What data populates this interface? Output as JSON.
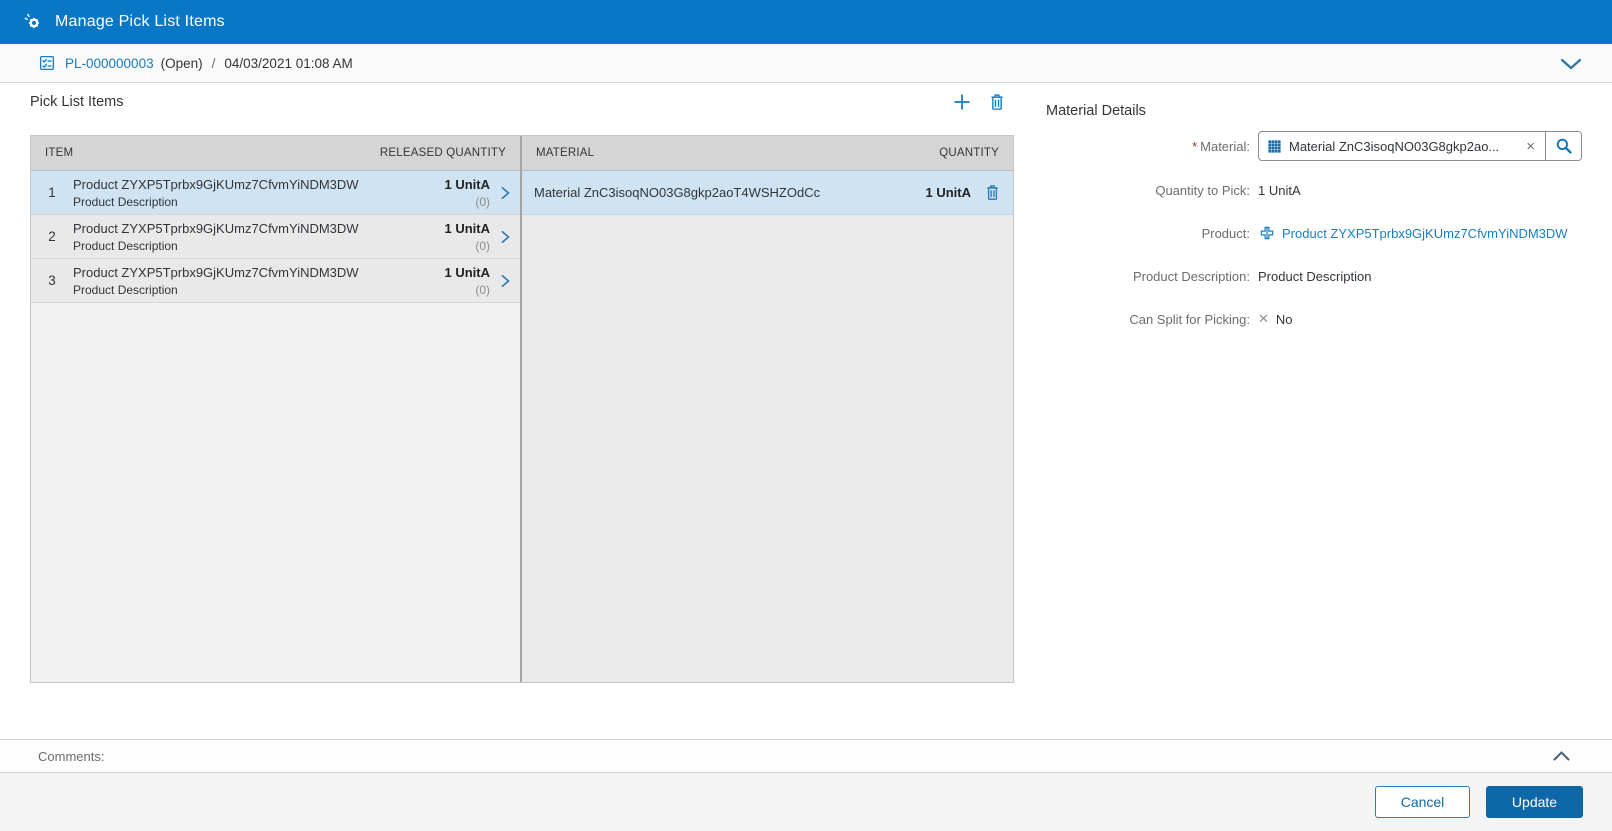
{
  "app": {
    "title": "Manage Pick List Items"
  },
  "object_header": {
    "id": "PL-000000003",
    "status": "(Open)",
    "separator": "/",
    "timestamp": "04/03/2021 01:08 AM"
  },
  "pick_list": {
    "title": "Pick List Items",
    "columns": {
      "item": "ITEM",
      "released_quantity": "RELEASED QUANTITY",
      "material": "MATERIAL",
      "quantity": "QUANTITY"
    },
    "items": [
      {
        "num": "1",
        "product": "Product ZYXP5Tprbx9GjKUmz7CfvmYiNDM3DW",
        "description": "Product Description",
        "released_qty": "1 UnitA",
        "released_count": "(0)"
      },
      {
        "num": "2",
        "product": "Product ZYXP5Tprbx9GjKUmz7CfvmYiNDM3DW",
        "description": "Product Description",
        "released_qty": "1 UnitA",
        "released_count": "(0)"
      },
      {
        "num": "3",
        "product": "Product ZYXP5Tprbx9GjKUmz7CfvmYiNDM3DW",
        "description": "Product Description",
        "released_qty": "1 UnitA",
        "released_count": "(0)"
      }
    ],
    "materials": [
      {
        "name": "Material ZnC3isoqNO03G8gkp2aoT4WSHZOdCc",
        "qty": "1 UnitA"
      }
    ]
  },
  "material_details": {
    "title": "Material Details",
    "required_marker": "*",
    "material_label": "Material:",
    "material_value": "Material ZnC3isoqNO03G8gkp2ao...",
    "quantity_label": "Quantity to Pick:",
    "quantity_value": "1 UnitA",
    "product_label": "Product:",
    "product_value": "Product ZYXP5Tprbx9GjKUmz7CfvmYiNDM3DW",
    "description_label": "Product Description:",
    "description_value": "Product Description",
    "split_label": "Can Split for Picking:",
    "split_value": "No"
  },
  "comments": {
    "label": "Comments:"
  },
  "actions": {
    "cancel": "Cancel",
    "update": "Update"
  },
  "icons": {
    "clear": "×",
    "no": "✕"
  },
  "colors": {
    "header_blue": "#0878c6",
    "link_blue": "#1a7dc0",
    "selected_row": "#cfe3f2",
    "update_button": "#0e67a6",
    "table_header": "#d5d5d5"
  }
}
